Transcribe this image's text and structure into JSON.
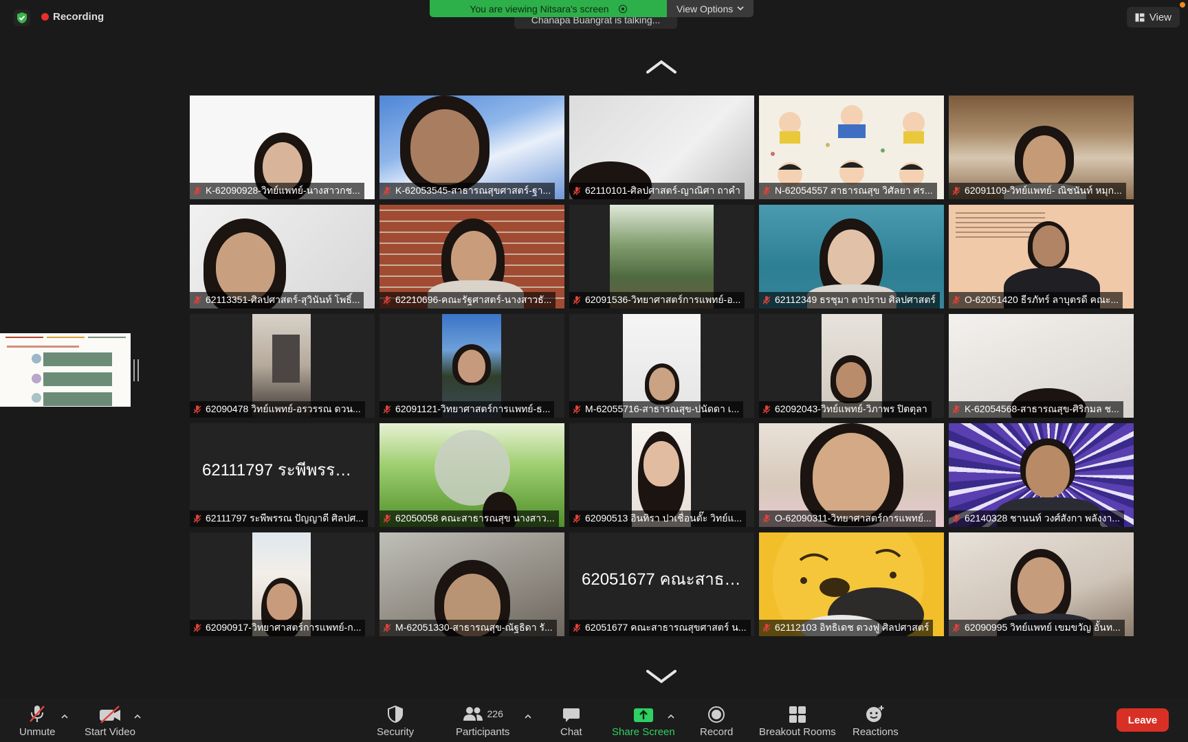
{
  "recording": {
    "label": "Recording"
  },
  "banner": {
    "viewing": "You are viewing Nitsara's screen",
    "view_options": "View Options"
  },
  "talking": {
    "text": "Chanapa Buangrat is talking..."
  },
  "view_button": {
    "label": "View"
  },
  "tiles": [
    {
      "name": "K-62090928-วิทย์แพทย์-นางสาวกช..."
    },
    {
      "name": "K-62053545-สาธารณสุขศาสตร์-ฐา..."
    },
    {
      "name": "62110101-ศิลปศาสตร์-ญาณิศา ถาคำ"
    },
    {
      "name": "N-62054557 สาธารณสุข วิศัลยา ศร..."
    },
    {
      "name": "62091109-วิทย์แพทย์- ณิชนันท์ หมุก..."
    },
    {
      "name": "62113351-ศิลปศาสตร์-สุวินันท์ โพธิ์..."
    },
    {
      "name": "62210696-คณะรัฐศาสตร์-นางสาวธั..."
    },
    {
      "name": "62091536-วิทยาศาสตร์การแพทย์-อ..."
    },
    {
      "name": "62112349 ธรชุมา ตาปราบ ศิลปศาสตร์"
    },
    {
      "name": "O-62051420 ธีรภัทร์ ลาบุตรดี คณะ..."
    },
    {
      "name": "62090478 วิทย์แพทย์-อรวรรณ ดวน..."
    },
    {
      "name": "62091121-วิทยาศาสตร์การแพทย์-ธ..."
    },
    {
      "name": "M-62055716-สาธารณสุข-ปนัดดา เ..."
    },
    {
      "name": "62092043-วิทย์แพทย์-วิภาพร ปิตตุลา"
    },
    {
      "name": "K-62054568-สาธารณสุข-ศิริกมล ช..."
    },
    {
      "name": "62111797 ระพีพรรณ ปัญญาดี ศิลปศ...",
      "big": "62111797 ระพีพรรณ..."
    },
    {
      "name": "62050058 คณะสาธารณสุข นางสาว..."
    },
    {
      "name": "62090513 อินทิรา ปาเชื่อนตั๊ะ วิทย์แ..."
    },
    {
      "name": "O-62090311-วิทยาศาสตร์การแพทย์..."
    },
    {
      "name": "62140328 ชานนท์ วงศ์สังกา พลังงา..."
    },
    {
      "name": "62090917-วิทยาศาสตร์การแพทย์-ก..."
    },
    {
      "name": "M-62051330-สาธารณสุข-ณัฐธิดา รั..."
    },
    {
      "name": "62051677 คณะสาธารณสุขศาสตร์ น...",
      "big": "62051677 คณะสาธา..."
    },
    {
      "name": "62112103 อิทธิเดช ดวงฟู ศิลปศาสตร์"
    },
    {
      "name": "62090995 วิทย์แพทย์ เขมขวัญ อั้นท..."
    }
  ],
  "toolbar": {
    "unmute": "Unmute",
    "start_video": "Start Video",
    "security": "Security",
    "participants": "Participants",
    "participants_count": "226",
    "chat": "Chat",
    "share_screen": "Share Screen",
    "record": "Record",
    "breakout_rooms": "Breakout Rooms",
    "reactions": "Reactions",
    "leave": "Leave"
  },
  "colors": {
    "accent_green": "#2db049",
    "leave_red": "#d93025",
    "recording_red": "#e5302b",
    "muted_red": "#e0423a"
  }
}
